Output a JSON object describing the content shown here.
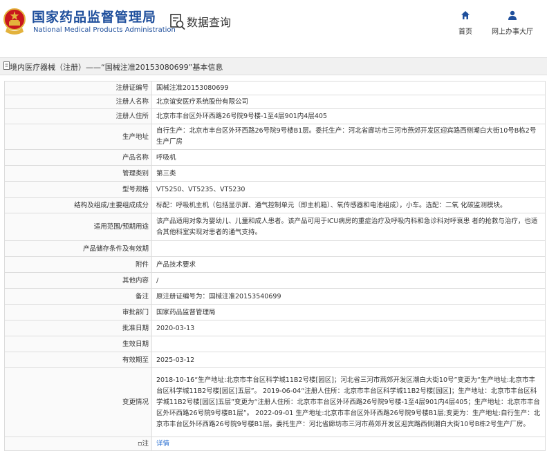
{
  "header": {
    "site_title": "国家药品监督管理局",
    "site_subtitle": "National Medical Products Administration",
    "section_title": "数据查询",
    "nav": [
      {
        "label": "首页",
        "icon": "home-icon"
      },
      {
        "label": "网上办事大厅",
        "icon": "user-icon"
      }
    ]
  },
  "breadcrumb": "境内医疗器械（注册）——“国械注准20153080699”基本信息",
  "rows": [
    {
      "label": "注册证编号",
      "value": "国械注准20153080699"
    },
    {
      "label": "注册人名称",
      "value": "北京谊安医疗系统股份有限公司"
    },
    {
      "label": "注册人住所",
      "value": "北京市丰台区外环西路26号院9号楼-1至4层901内4层405"
    },
    {
      "label": "生产地址",
      "value": "自行生产：北京市丰台区外环西路26号院9号楼B1层。委托生产：河北省廊坊市三河市燕郊开发区迎宾路西侧潮白大街10号B栋2号生产厂房"
    },
    {
      "label": "产品名称",
      "value": "呼吸机"
    },
    {
      "label": "管理类别",
      "value": "第三类"
    },
    {
      "label": "型号规格",
      "value": "VT5250、VT5235、VT5230"
    },
    {
      "label": "结构及组成/主要组成成分",
      "value": "标配：呼吸机主机（包括显示屏、通气控制单元（即主机箱）、氧传感器和电池组成），小车。选配：二氧 化碳监测模块。"
    },
    {
      "label": "适用范围/预期用途",
      "value": "该产品适用对象为婴幼儿、儿童和成人患者。该产品可用于ICU病房的重症治疗及呼吸内科和急诊科对呼衰患 者的抢救与治疗，也适合其他科室实现对患者的通气支持。"
    },
    {
      "label": "产品储存条件及有效期",
      "value": ""
    },
    {
      "label": "附件",
      "value": "产品技术要求"
    },
    {
      "label": "其他内容",
      "value": "/"
    },
    {
      "label": "备注",
      "value": "原注册证编号为：国械注准20153540699"
    },
    {
      "label": "审批部门",
      "value": "国家药品监督管理局"
    },
    {
      "label": "批准日期",
      "value": "2020-03-13"
    },
    {
      "label": "生效日期",
      "value": ""
    },
    {
      "label": "有效期至",
      "value": "2025-03-12"
    },
    {
      "label": "变更情况",
      "value": "2018-10-16“生产地址:北京市丰台区科学城11B2号楼[园区]；河北省三河市燕郊开发区潮白大街10号”变更为“生产地址:北京市丰台区科学城11B2号楼[园区]五层”。 2019-06-04“注册人住所：北京市丰台区科学城11B2号楼[园区]；生产地址：北京市丰台区科学城11B2号楼[园区]五层”变更为“注册人住所：北京市丰台区外环西路26号院9号楼-1至4层901内4层405；生产地址：北京市丰台区外环西路26号院9号楼B1层”。 2022-09-01 生产地址:北京市丰台区外环西路26号院9号楼B1层;变更为：生产地址:自行生产：北京市丰台区外环西路26号院9号楼B1层。委托生产：河北省廊坊市三河市燕郊开发区迎宾路西侧潮白大街10号B栋2号生产厂房。"
    },
    {
      "label": "注",
      "value": "详情"
    }
  ],
  "colors": {
    "brand": "#1f4f9c",
    "link": "#2a6fd1",
    "emblem_red": "#c8161d",
    "emblem_gold": "#e3b23c"
  }
}
